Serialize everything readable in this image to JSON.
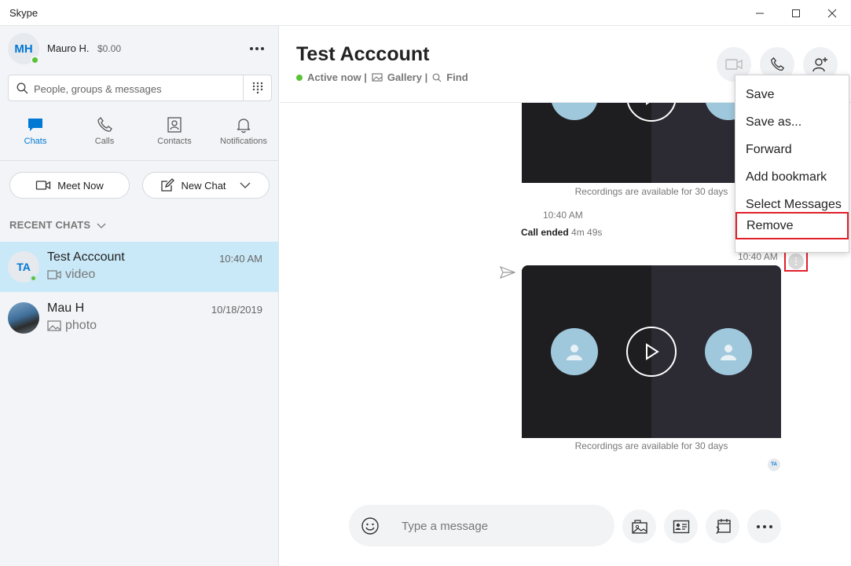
{
  "window": {
    "title": "Skype"
  },
  "profile": {
    "initials": "MH",
    "name": "Mauro H.",
    "credit": "$0.00"
  },
  "search": {
    "placeholder": "People, groups & messages"
  },
  "nav": [
    {
      "label": "Chats",
      "icon": "chat-icon",
      "active": true
    },
    {
      "label": "Calls",
      "icon": "phone-icon",
      "active": false
    },
    {
      "label": "Contacts",
      "icon": "contacts-icon",
      "active": false
    },
    {
      "label": "Notifications",
      "icon": "bell-icon",
      "active": false
    }
  ],
  "actions": {
    "meet_now": "Meet Now",
    "new_chat": "New Chat"
  },
  "recent_chats": {
    "label": "RECENT CHATS",
    "items": [
      {
        "initials": "TA",
        "name": "Test Acccount",
        "time": "10:40 AM",
        "preview": "video",
        "preview_icon": "video-icon",
        "active": true,
        "online": true
      },
      {
        "initials": "",
        "name": "Mau H",
        "time": "10/18/2019",
        "preview": "photo",
        "preview_icon": "image-icon",
        "active": false,
        "online": false
      }
    ]
  },
  "conversation": {
    "title": "Test Acccount",
    "status": "Active now |",
    "gallery": "Gallery |",
    "find": "Find"
  },
  "messages": {
    "recording_note_1": "Recordings are available for 30 days",
    "time_1": "10:40 AM",
    "call_ended_label": "Call ended",
    "call_duration": "4m 49s",
    "time_2": "10:40 AM",
    "recording_note_2": "Recordings are available for 30 days",
    "read_receipt_initials": "TA"
  },
  "context_menu": {
    "items": [
      "Save",
      "Save as...",
      "Forward",
      "Add bookmark",
      "Select Messages",
      "Remove"
    ],
    "highlighted": "Remove"
  },
  "composer": {
    "placeholder": "Type a message"
  },
  "colors": {
    "accent": "#0078d4",
    "online": "#5bc236",
    "highlight": "#e0202a",
    "selected_chat": "#c9e9f8"
  }
}
